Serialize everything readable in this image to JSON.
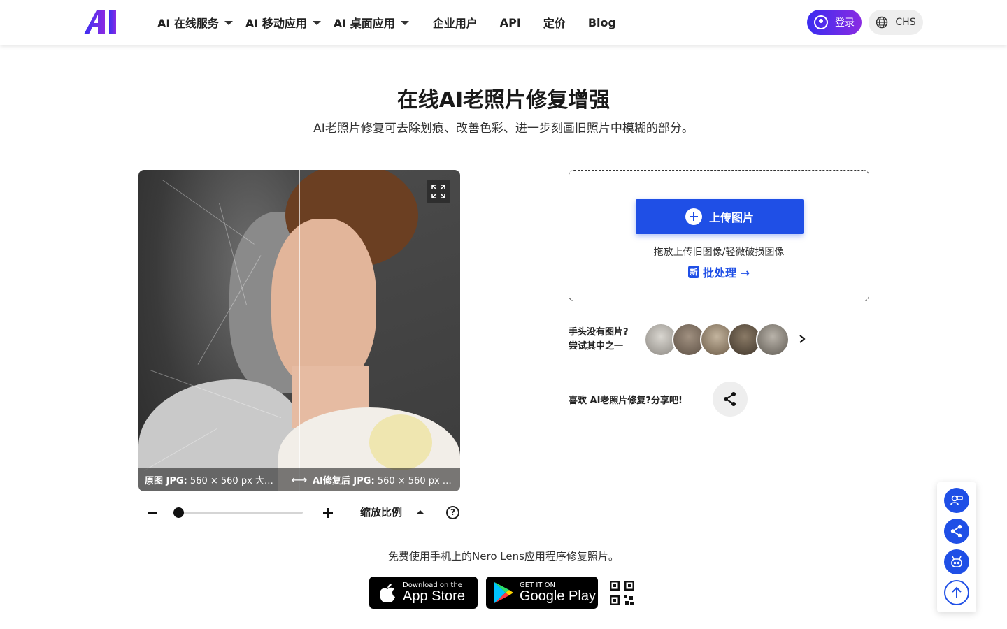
{
  "header": {
    "logo_text": "AI",
    "nav": [
      {
        "label": "AI 在线服务",
        "dropdown": true
      },
      {
        "label": "AI 移动应用",
        "dropdown": true
      },
      {
        "label": "AI 桌面应用",
        "dropdown": true
      },
      {
        "label": "企业用户",
        "dropdown": false
      },
      {
        "label": "API",
        "dropdown": false
      },
      {
        "label": "定价",
        "dropdown": false
      },
      {
        "label": "Blog",
        "dropdown": false
      }
    ],
    "login_label": "登录",
    "lang_label": "CHS"
  },
  "hero": {
    "title": "在线AI老照片修复增强",
    "subtitle": "AI老照片修复可去除划痕、改善色彩、进一步刻画旧照片中模糊的部分。"
  },
  "compare": {
    "left_caption_bold": "原图 JPG:",
    "left_caption_rest": " 560 × 560 px   大…",
    "right_caption_bold": "AI修复后 JPG:",
    "right_caption_rest": " 560 × 560 px   …",
    "arrow": "⟷"
  },
  "zoom": {
    "label": "缩放比例",
    "help": "?",
    "level": 0
  },
  "upload": {
    "button_label": "上传图片",
    "hint": "拖放上传旧图像/轻微破损图像",
    "batch_badge": "新",
    "batch_label": "批处理 →"
  },
  "samples": {
    "line1": "手头没有图片?",
    "line2": "尝试其中之一"
  },
  "share": {
    "label": "喜欢 AI老照片修复?分享吧!"
  },
  "promo": {
    "text": "免费使用手机上的Nero Lens应用程序修复照片。",
    "appstore_small": "Download on the",
    "appstore_big": "App Store",
    "googleplay_small": "GET IT ON",
    "googleplay_big": "Google Play"
  },
  "colors": {
    "accent": "#1f4fe6",
    "login_gradient_start": "#3a2cf0",
    "login_gradient_end": "#8a2be2"
  }
}
